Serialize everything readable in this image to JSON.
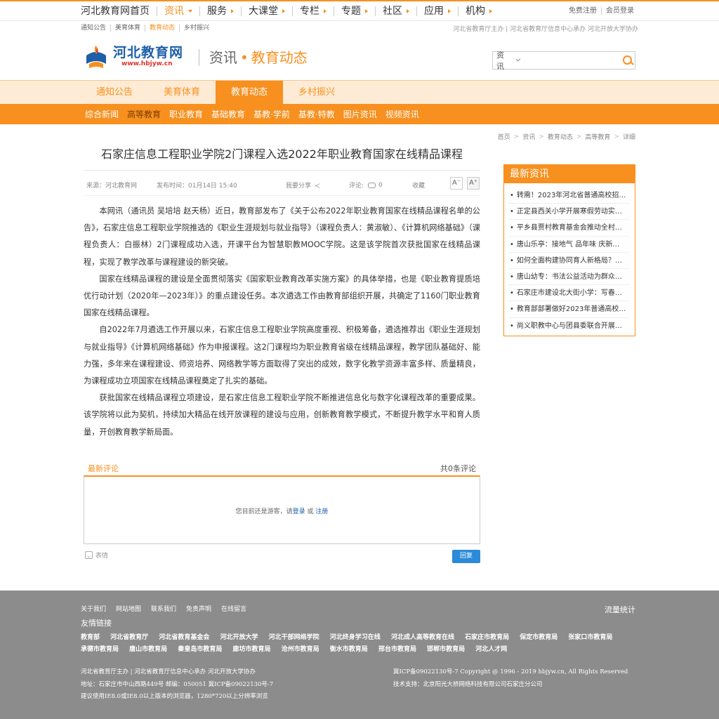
{
  "topnav": {
    "items": [
      {
        "label": "河北教育网首页",
        "arrow": false
      },
      {
        "label": "资讯",
        "arrow": true
      },
      {
        "label": "服务",
        "arrow": true
      },
      {
        "label": "大课堂",
        "arrow": true
      },
      {
        "label": "专栏",
        "arrow": true
      },
      {
        "label": "专题",
        "arrow": true
      },
      {
        "label": "社区",
        "arrow": true
      },
      {
        "label": "应用",
        "arrow": true
      },
      {
        "label": "机构",
        "arrow": true
      }
    ],
    "register": "免费注册",
    "login": "会员登录"
  },
  "subbar": {
    "links": [
      "通知公告",
      "美育体育",
      "教育动态",
      "乡村振兴"
    ],
    "sponsors": "河北省教育厅主办 | 河北省教育厅信息中心承办 河北开放大学协办"
  },
  "header": {
    "logo_cn": "河北教育网",
    "logo_en": "www.hbjyw.cn",
    "section": "资讯",
    "dot": "•",
    "subsection": "教育动态",
    "search_scope": "资讯",
    "search_placeholder": ""
  },
  "channel_tabs": [
    "通知公告",
    "美育体育",
    "教育动态",
    "乡村振兴"
  ],
  "categories": [
    "综合新闻",
    "高等教育",
    "职业教育",
    "基础教育",
    "基教·学前",
    "基教·特教",
    "图片资讯",
    "视频资讯"
  ],
  "breadcrumb": [
    "首页",
    "资讯",
    "教育动态",
    "高等教育",
    "详细"
  ],
  "article": {
    "title": "石家庄信息工程职业学院2门课程入选2022年职业教育国家在线精品课程",
    "source": "来源：河北教育网",
    "time": "发布时间：01月14日 15:40",
    "share": "我要分享",
    "comment_label": "评论:",
    "comment_count": "0",
    "favorite": "收藏",
    "font_minus": "A⁻",
    "font_plus": "A⁺",
    "paragraphs": [
      "本网讯（通讯员 吴培培 赵天杨）近日，教育部发布了《关于公布2022年职业教育国家在线精品课程名单的公告》，石家庄信息工程职业学院推选的《职业生涯规划与就业指导》（课程负责人：黄淑敏）、《计算机网络基础》（课程负责人：白振林）2门课程成功入选，开课平台为智慧职教MOOC学院。这是该学院首次获批国家在线精品课程，实现了教学改革与课程建设的新突破。",
      "国家在线精品课程的建设是全面贯彻落实《国家职业教育改革实施方案》的具体举措，也是《职业教育提质培优行动计划（2020年—2023年）》的重点建设任务。本次遴选工作由教育部组织开展，共确定了1160门职业教育国家在线精品课程。",
      "自2022年7月遴选工作开展以来，石家庄信息工程职业学院高度重视、积极筹备，遴选推荐出《职业生涯规划与就业指导》《计算机网络基础》作为申报课程。这2门课程均为职业教育省级在线精品课程，教学团队基础好、能力强，多年来在课程建设、师资培养、网络教学等方面取得了突出的成效，数字化教学资源丰富多样、质量精良，为课程成功立项国家在线精品课程奠定了扎实的基础。",
      "获批国家在线精品课程立项建设，是石家庄信息工程职业学院不断推进信息化与数字化课程改革的重要成果。该学院将以此为契机，持续加大精品在线开放课程的建设与应用，创新教育教学模式，不断提升教学水平和育人质量，开创教育教学新局面。"
    ]
  },
  "comments": {
    "title": "最新评论",
    "total": "共0条评论",
    "guest_text": "您目前还是游客，请",
    "login": "登录",
    "or": " 或 ",
    "register": "注册",
    "face": "表情",
    "reply": "回复"
  },
  "sidebar": {
    "title": "最新资讯",
    "items": [
      "转需！2023年河北省普通高校招生…",
      "正定县西关小学开展寒假劳动实…",
      "平乡县贾村教育基金会推动全村…",
      "唐山乐亭：接地气 品年味 庆新…",
      "如何全面构建协同育人新格局？…",
      "唐山幼专：书法公益活动为群众…",
      "石家庄市建设北大街小学：写春…",
      "教育部部署做好2023年普通高校…",
      "尚义职教中心与团县委联合开展…"
    ]
  },
  "footer": {
    "links": [
      "关于我们",
      "网站地图",
      "联系我们",
      "免责声明",
      "在线留言"
    ],
    "stats": "流量统计",
    "friend_title": "友情链接",
    "friends": [
      "教育部",
      "河北省教育厅",
      "河北省教育基金会",
      "河北开放大学",
      "河北干部网络学院",
      "河北终身学习在线",
      "河北成人高等教育在线",
      "石家庄市教育局",
      "保定市教育局",
      "张家口市教育局",
      "承德市教育局",
      "唐山市教育局",
      "秦皇岛市教育局",
      "廊坊市教育局",
      "沧州市教育局",
      "衡水市教育局",
      "邢台市教育局",
      "邯郸市教育局",
      "河北人才网"
    ],
    "info": [
      "河北省教育厅主办 | 河北省教育厅信息中心承办 河北开放大学协办",
      "地址：石家庄市中山西路449号 邮编：050051 冀ICP备09022130号-7",
      "建议使用IE8.0或IE8.0以上版本的浏览器，1280*720以上分辨率浏览"
    ],
    "copyright": "冀ICP备09022130号-7 Copyright @ 1996 - 2019 hbjyw.cn, All Rights Reserved",
    "tech": "技术支持：北京阳光大桥网络科技有限公司石家庄分公司"
  },
  "colors": {
    "accent": "#f7901e",
    "link": "#1d5fa8",
    "footer_bg": "#8c8c8c",
    "reply_btn": "#2b8bd8"
  }
}
